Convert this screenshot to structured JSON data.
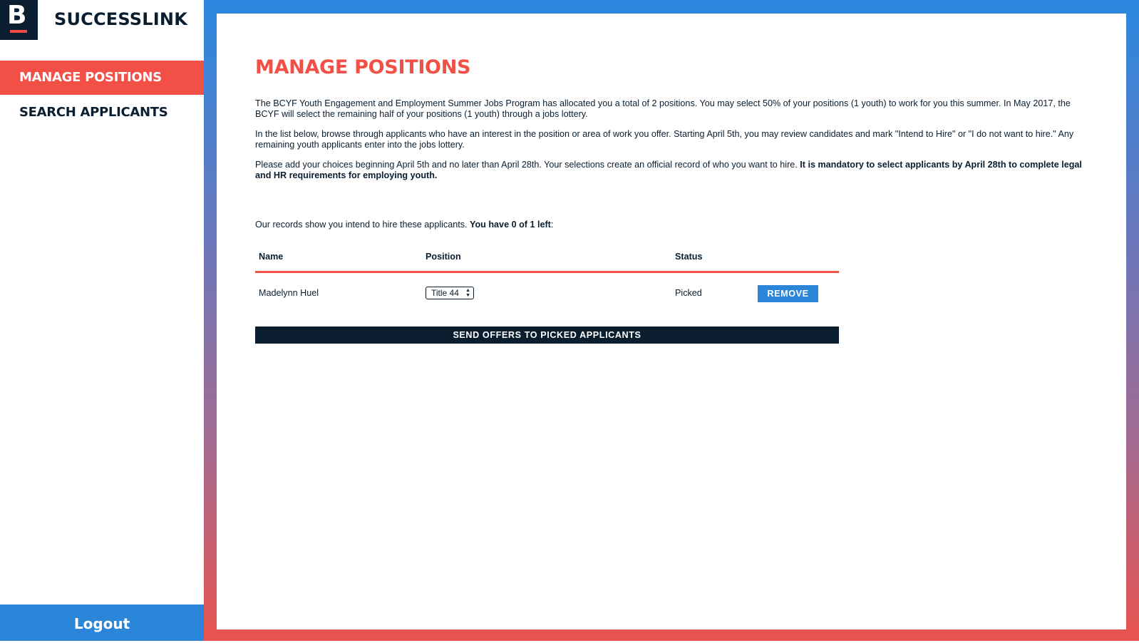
{
  "brand": {
    "logo_letter": "B",
    "app_title": "SUCCESSLINK"
  },
  "sidebar": {
    "items": [
      {
        "label": "MANAGE POSITIONS",
        "active": true
      },
      {
        "label": "SEARCH APPLICANTS",
        "active": false
      }
    ],
    "logout_label": "Logout"
  },
  "main": {
    "title": "MANAGE POSITIONS",
    "paragraph1": "The BCYF Youth Engagement and Employment Summer Jobs Program has allocated you a total of 2 positions. You may select 50% of your positions (1 youth) to work for you this summer. In May 2017, the BCYF will select the remaining half of your positions (1 youth) through a jobs lottery.",
    "paragraph2": "In the list below, browse through applicants who have an interest in the position or area of work you offer. Starting April 5th, you may review candidates and mark \"Intend to Hire\" or \"I do not want to hire.\" Any remaining youth applicants enter into the jobs lottery.",
    "paragraph3_plain": "Please add your choices beginning April 5th and no later than April 28th. Your selections create an official record of who you want to hire. ",
    "paragraph3_bold": "It is mandatory to select applicants by April 28th to complete legal and HR requirements for employing youth.",
    "records_plain": "Our records show you intend to hire these applicants. ",
    "records_bold": "You have 0 of 1 left",
    "records_suffix": ":"
  },
  "table": {
    "headers": {
      "name": "Name",
      "position": "Position",
      "status": "Status"
    },
    "rows": [
      {
        "name": "Madelynn Huel",
        "position": "Title 44",
        "status": "Picked",
        "action": "REMOVE"
      }
    ]
  },
  "actions": {
    "send_offers_label": "SEND OFFERS TO PICKED APPLICANTS"
  },
  "colors": {
    "accent_red": "#f24f46",
    "accent_blue": "#2b86d9",
    "navy": "#0a1e30"
  }
}
